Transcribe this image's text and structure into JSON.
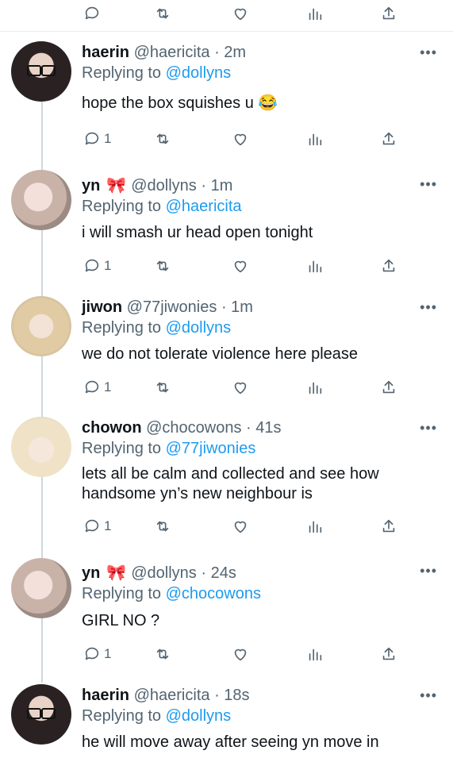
{
  "actions": {
    "reply_icon": "reply-icon",
    "retweet_icon": "retweet-icon",
    "like_icon": "like-icon",
    "analytics_icon": "analytics-icon",
    "share_icon": "share-icon"
  },
  "replies": [
    {
      "name": "haerin",
      "handle": "@haericita",
      "time": "2m",
      "replying_label": "Replying to",
      "replying_to": "@dollyns",
      "text": "hope the box squishes u 😂",
      "reply_count": "1"
    },
    {
      "name": "yn",
      "bow": "🎀",
      "handle": "@dollyns",
      "time": "1m",
      "replying_label": "Replying to",
      "replying_to": "@haericita",
      "text": "i will smash ur head open tonight",
      "reply_count": "1"
    },
    {
      "name": "jiwon",
      "handle": "@77jiwonies",
      "time": "1m",
      "replying_label": "Replying to",
      "replying_to": "@dollyns",
      "text": "we do not tolerate violence here please",
      "reply_count": "1"
    },
    {
      "name": "chowon",
      "handle": "@chocowons",
      "time": "41s",
      "replying_label": "Replying to",
      "replying_to": "@77jiwonies",
      "text": "lets all be calm and collected and see how handsome yn’s new neighbour is",
      "reply_count": "1"
    },
    {
      "name": "yn",
      "bow": "🎀",
      "handle": "@dollyns",
      "time": "24s",
      "replying_label": "Replying to",
      "replying_to": "@chocowons",
      "text": "GIRL NO ?",
      "reply_count": "1"
    },
    {
      "name": "haerin",
      "handle": "@haericita",
      "time": "18s",
      "replying_label": "Replying to",
      "replying_to": "@dollyns",
      "text": "he will move away after seeing yn move in"
    }
  ],
  "separator": "·",
  "more_label": "•••"
}
